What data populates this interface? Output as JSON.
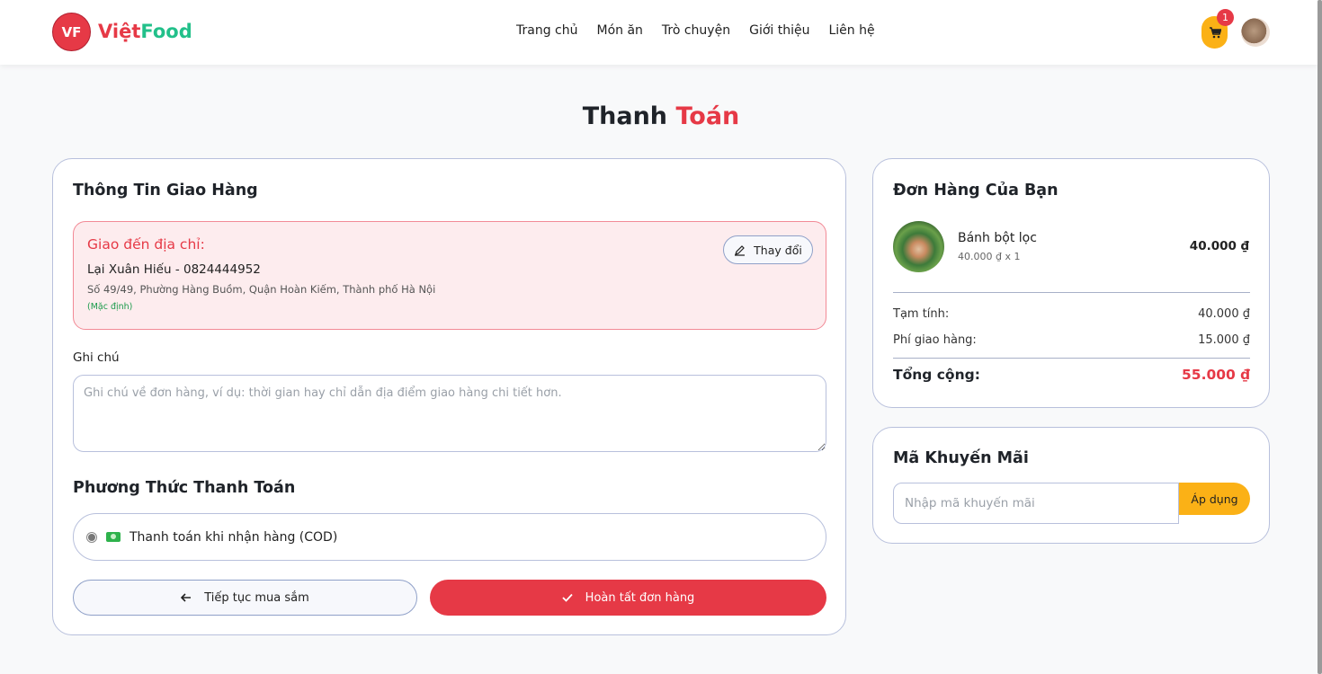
{
  "header": {
    "logo_text": "VF",
    "brand_part1": "Việt",
    "brand_part2": "Food",
    "nav": [
      "Trang chủ",
      "Món ăn",
      "Trò chuyện",
      "Giới thiệu",
      "Liên hệ"
    ],
    "cart_count": "1"
  },
  "page": {
    "title_part1": "Thanh",
    "title_part2": "Toán"
  },
  "shipping": {
    "title": "Thông Tin Giao Hàng",
    "address_heading": "Giao đến địa chỉ:",
    "recipient": "Lại Xuân Hiếu - 0824444952",
    "address": "Số 49/49, Phường Hàng Buồm, Quận Hoàn Kiếm, Thành phố Hà Nội",
    "default_tag": "(Mặc định)",
    "change_label": "Thay đổi",
    "note_label": "Ghi chú",
    "note_placeholder": "Ghi chú về đơn hàng, ví dụ: thời gian hay chỉ dẫn địa điểm giao hàng chi tiết hơn."
  },
  "payment": {
    "title": "Phương Thức Thanh Toán",
    "option": "Thanh toán khi nhận hàng (COD)"
  },
  "actions": {
    "back_label": "Tiếp tục mua sắm",
    "submit_label": "Hoàn tất đơn hàng"
  },
  "order": {
    "title": "Đơn Hàng Của Bạn",
    "item_name": "Bánh bột lọc",
    "item_sub": "40.000 ₫ x 1",
    "item_price": "40.000 ₫",
    "subtotal_label": "Tạm tính:",
    "subtotal_value": "40.000 ₫",
    "shipping_label": "Phí giao hàng:",
    "shipping_value": "15.000 ₫",
    "total_label": "Tổng cộng:",
    "total_value": "55.000 ₫"
  },
  "promo": {
    "title": "Mã Khuyến Mãi",
    "placeholder": "Nhập mã khuyến mãi",
    "apply_label": "Áp dụng"
  },
  "colors": {
    "primary": "#e63946",
    "accent": "#fbb116",
    "brand_green": "#22c08a"
  }
}
